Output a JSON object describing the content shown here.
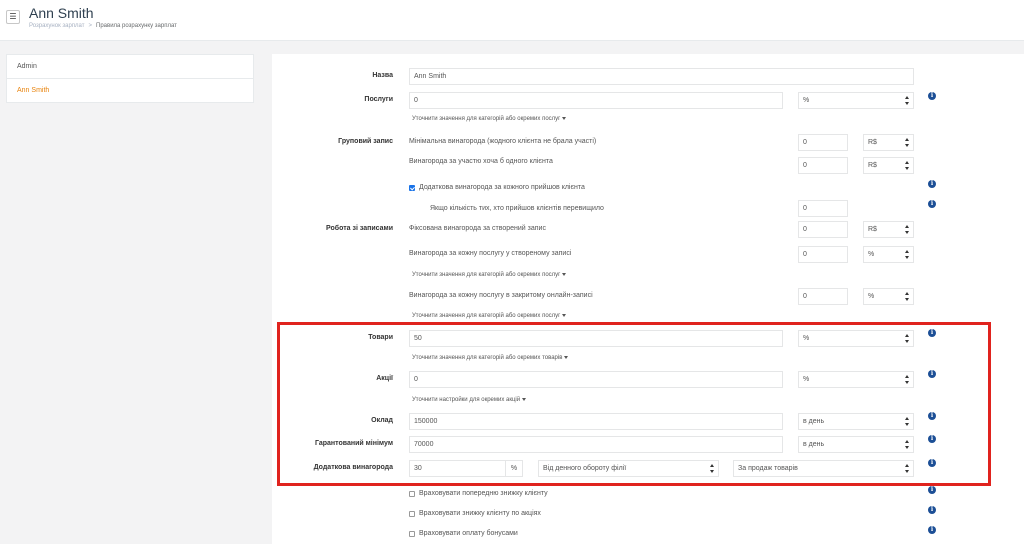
{
  "header": {
    "menu_icon": "☰",
    "title": "Ann Smith",
    "breadcrumb": [
      "Розрахунок зарплат",
      ">",
      "Правила розрахунку зарплат"
    ]
  },
  "sidebar": {
    "items": [
      {
        "label": "Admin",
        "active": false
      },
      {
        "label": "Ann Smith",
        "active": true
      }
    ]
  },
  "form": {
    "name": {
      "label": "Назва",
      "value": "Ann Smith"
    },
    "services": {
      "label": "Послуги",
      "value": "0",
      "unit": "%",
      "refine_link": "Уточнити значення для категорій або окремих послуг"
    },
    "group": {
      "label": "Груповий запис",
      "min_reward_label": "Мінімальна винагорода (жодного клієнта не брала участі)",
      "min_reward_value": "0",
      "min_reward_unit": "R$",
      "per_client_label": "Винагорода за участю хоча б одного клієнта",
      "per_client_value": "0",
      "per_client_unit": "R$",
      "extra_label": "Додаткова винагорода за кожного прийшов клієнта",
      "extra_checked": true,
      "threshold_label": "Якщо кількість тих, хто прийшов клієнтів перевищило",
      "threshold_value": "0"
    },
    "bookings": {
      "label": "Робота зі записами",
      "fixed_label": "Фіксована винагорода за створений запис",
      "fixed_value": "0",
      "fixed_unit": "R$",
      "per_service_label": "Винагорода за кожну послугу у створеному записі",
      "per_service_value": "0",
      "per_service_unit": "%",
      "refine_link1": "Уточнити значення для категорій або окремих послуг",
      "online_label": "Винагорода за кожну послугу в закритому онлайн-записі",
      "online_value": "0",
      "online_unit": "%",
      "refine_link2": "Уточнити значення для категорій або окремих послуг"
    },
    "goods": {
      "label": "Товари",
      "value": "50",
      "unit": "%",
      "refine_link": "Уточнити значення для категорій або окремих товарів"
    },
    "promos": {
      "label": "Акції",
      "value": "0",
      "unit": "%",
      "refine_link": "Уточнити настройки для окремих акцій"
    },
    "salary": {
      "label": "Оклад",
      "value": "150000",
      "period": "в день"
    },
    "guaranteed": {
      "label": "Гарантований мінімум",
      "value": "70000",
      "period": "в день"
    },
    "bonus": {
      "label": "Додаткова винагорода",
      "value": "30",
      "unit": "%",
      "base": "Від денного обороту філії",
      "scope": "За продаж товарів"
    },
    "checkboxes": [
      {
        "label": "Враховувати попередню знижку клієнту",
        "checked": false
      },
      {
        "label": "Враховувати знижку клієнту по акціях",
        "checked": false
      },
      {
        "label": "Враховувати оплату бонусами",
        "checked": false
      }
    ],
    "info_icon": "i"
  },
  "colors": {
    "highlight": "#e0231e",
    "active_sidebar": "#e8830c",
    "info": "#1c4f96",
    "checkbox": "#1a73e8"
  }
}
